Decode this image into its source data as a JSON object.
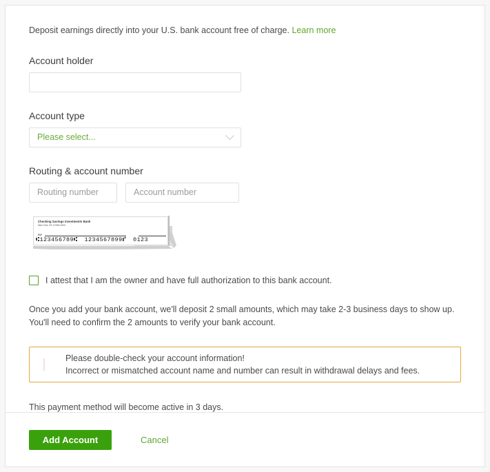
{
  "intro": {
    "text": "Deposit earnings directly into your U.S. bank account free of charge.",
    "link_label": "Learn more"
  },
  "sections": {
    "account_holder_label": "Account holder",
    "account_type_label": "Account type",
    "routing_account_label": "Routing & account number"
  },
  "fields": {
    "account_holder_value": "",
    "account_holder_placeholder": "",
    "account_type_selected": "Please select...",
    "routing_placeholder": "Routing number",
    "routing_value": "",
    "account_placeholder": "Account number",
    "account_value": ""
  },
  "check_image": {
    "bank_name": "Checking Savings Investments Bank",
    "bank_address": "New York, NY 12345-0000",
    "pay_tag": "PAY",
    "micr_routing": "⑆123456789⑆",
    "micr_account": "1234567899⑈",
    "micr_check_no": "0123"
  },
  "attest": {
    "label": "I attest that I am the owner and have full authorization to this bank account.",
    "checked": false
  },
  "note": "Once you add your bank account, we'll deposit 2 small amounts, which may take 2-3 business days to show up. You'll need to confirm the 2 amounts to verify your bank account.",
  "warning": {
    "title": "Please double-check your account information!",
    "detail": "Incorrect or mismatched account name and number can result in withdrawal delays and fees.",
    "border_color": "#e0a83c"
  },
  "active_note": "This payment method will become active in 3 days.",
  "footer": {
    "submit_label": "Add Account",
    "cancel_label": "Cancel"
  },
  "colors": {
    "accent_green": "#3aa10c",
    "link_green": "#5fa62c",
    "warning_amber": "#e0a83c"
  }
}
